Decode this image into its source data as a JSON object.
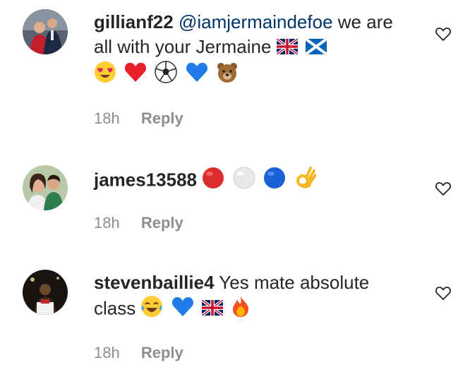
{
  "comments": [
    {
      "username": "gillianf22",
      "mention": "@iamjermaindefoe",
      "text": " we are all with your Jermaine",
      "emojis": [
        "gb-flag",
        "scotland-flag",
        "heart-eyes",
        "red-heart",
        "soccer-ball",
        "blue-heart",
        "bear"
      ],
      "time": "18h",
      "reply_label": "Reply"
    },
    {
      "username": "james13588",
      "mention": "",
      "text": "",
      "emojis": [
        "red-circle",
        "white-circle",
        "blue-circle",
        "ok-hand"
      ],
      "time": "18h",
      "reply_label": "Reply"
    },
    {
      "username": "stevenbaillie4",
      "mention": "",
      "text": " Yes mate absolute class",
      "emojis": [
        "tears-of-joy",
        "blue-heart",
        "gb-flag",
        "fire"
      ],
      "time": "18h",
      "reply_label": "Reply"
    }
  ],
  "colors": {
    "text": "#262626",
    "mention": "#003569",
    "meta": "#8e8e8e"
  }
}
